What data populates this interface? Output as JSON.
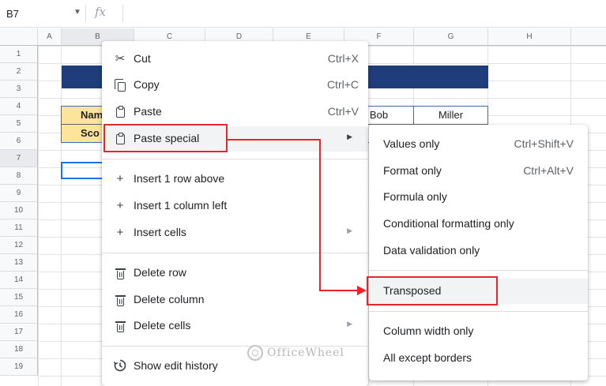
{
  "formula_bar": {
    "name_box": "B7",
    "fx_label": "fx",
    "value": ""
  },
  "columns": [
    "A",
    "B",
    "C",
    "D",
    "E",
    "F",
    "G",
    "H"
  ],
  "rows": [
    "1",
    "2",
    "3",
    "4",
    "5",
    "6",
    "7",
    "8",
    "9",
    "10",
    "11",
    "12",
    "13",
    "14",
    "15",
    "16",
    "17",
    "18",
    "19"
  ],
  "cells": {
    "b4": "Nam",
    "b5": "Sco",
    "f4": "Bob",
    "g4": "Miller"
  },
  "context_menu": {
    "cut": {
      "label": "Cut",
      "shortcut": "Ctrl+X",
      "icon": "scissors-icon"
    },
    "copy": {
      "label": "Copy",
      "shortcut": "Ctrl+C",
      "icon": "copy-icon"
    },
    "paste": {
      "label": "Paste",
      "shortcut": "Ctrl+V",
      "icon": "clipboard-icon"
    },
    "paste_special": {
      "label": "Paste special",
      "icon": "clipboard-icon"
    },
    "insert_row": {
      "label": "Insert 1 row above",
      "icon": "plus-icon"
    },
    "insert_col": {
      "label": "Insert 1 column left",
      "icon": "plus-icon"
    },
    "insert_cells": {
      "label": "Insert cells",
      "icon": "plus-icon"
    },
    "delete_row": {
      "label": "Delete row",
      "icon": "trash-icon"
    },
    "delete_col": {
      "label": "Delete column",
      "icon": "trash-icon"
    },
    "delete_cells": {
      "label": "Delete cells",
      "icon": "trash-icon"
    },
    "edit_history": {
      "label": "Show edit history",
      "icon": "history-icon"
    }
  },
  "submenu": {
    "values_only": {
      "label": "Values only",
      "shortcut": "Ctrl+Shift+V"
    },
    "format_only": {
      "label": "Format only",
      "shortcut": "Ctrl+Alt+V"
    },
    "formula_only": {
      "label": "Formula only"
    },
    "conditional": {
      "label": "Conditional formatting only"
    },
    "data_validation": {
      "label": "Data validation only"
    },
    "transposed": {
      "label": "Transposed"
    },
    "column_width": {
      "label": "Column width only"
    },
    "all_except_borders": {
      "label": "All except borders"
    }
  },
  "watermark": "OfficeWheel",
  "colors": {
    "annotation": "#e8252b",
    "banner": "#1f3d7a",
    "header_fill": "#fde49a",
    "selection": "#1a73e8"
  }
}
